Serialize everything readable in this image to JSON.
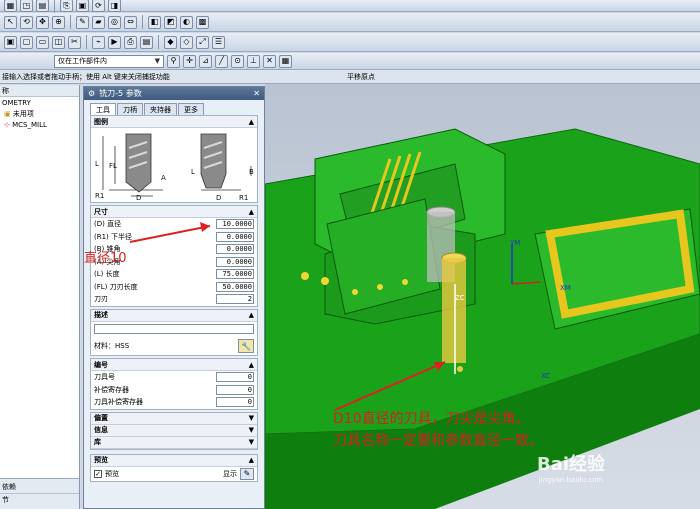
{
  "toolbar2": {
    "combo_label": "仅在工作部件内"
  },
  "statusbar": {
    "prompt": "接输入选择或者拖动手柄；使用 Alt 键来关闭捕捉功能",
    "snap_label": "平移原点"
  },
  "nav": {
    "header": "称",
    "rows": [
      {
        "label": "OMETRY"
      },
      {
        "label": "未用项"
      },
      {
        "label": "MCS_MILL"
      }
    ],
    "bottom_labels": [
      "依赖",
      "节"
    ]
  },
  "dialog": {
    "title": "铣刀-5 参数",
    "tabs": [
      "工具",
      "刀柄",
      "夹持器",
      "更多"
    ],
    "groups": {
      "figure": "图例",
      "dimensions": "尺寸",
      "description": "描述",
      "number": "编号",
      "offset": "偏置",
      "info": "信息",
      "library": "库",
      "preview": "预览"
    },
    "fields": [
      {
        "label": "(D) 直径",
        "value": "10.0000"
      },
      {
        "label": "(R1) 下半径",
        "value": "0.0000"
      },
      {
        "label": "(B) 锥角",
        "value": "0.0000"
      },
      {
        "label": "(A) 尖角",
        "value": "0.0000"
      },
      {
        "label": "(L) 长度",
        "value": "75.0000"
      },
      {
        "label": "(FL) 刀刃长度",
        "value": "50.0000"
      },
      {
        "label": "刀刃",
        "value": "2"
      }
    ],
    "material": "材料：HSS",
    "number_fields": [
      {
        "label": "刀具号",
        "value": "0"
      },
      {
        "label": "补偿寄存器",
        "value": "0"
      },
      {
        "label": "刀具补偿寄存器",
        "value": "0"
      }
    ],
    "preview_check": "预览",
    "show_label": "显示"
  },
  "annotation": {
    "diameter": "直径10",
    "line1": "D10直径的刀具，刀尖是尖角。",
    "line2": "刀具名称一定要和参数直径一致。"
  },
  "axis_labels": {
    "xc": "XC",
    "zc": "ZC",
    "ym": "YM",
    "xm": "XM"
  },
  "watermark": {
    "text": "Bai经验",
    "url": "jingyan.baidu.com"
  }
}
